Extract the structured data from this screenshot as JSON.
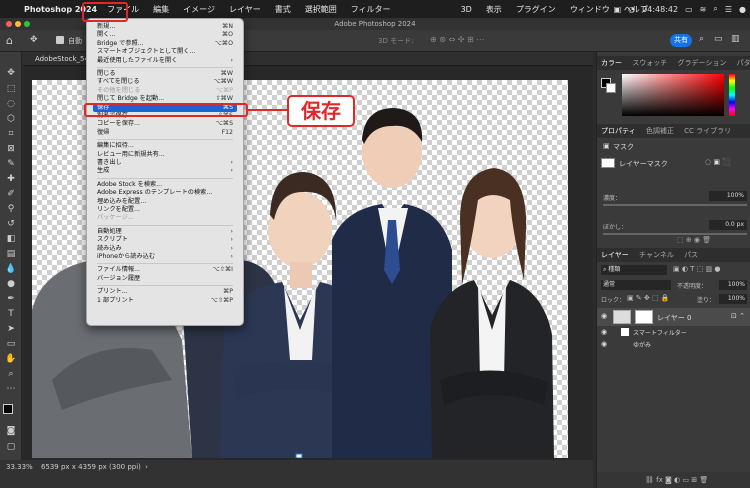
{
  "mac_menu": {
    "app_name": "Photoshop 2024",
    "items": [
      "ファイル",
      "編集",
      "イメージ",
      "レイヤー",
      "書式",
      "選択範囲",
      "フィルター",
      "3D",
      "表示",
      "プラグイン",
      "ウィンドウ",
      "ヘルプ"
    ],
    "clock": "04:48:42"
  },
  "window": {
    "title": "Adobe Photoshop 2024"
  },
  "options_bar": {
    "auto_select_label": "自動",
    "mode_3d": "3D モード:",
    "share_label": "共有"
  },
  "document": {
    "tab_title": "AdobeStock_54"
  },
  "status": {
    "zoom": "33.33%",
    "doc_info": "6539 px x 4359 px (300 ppi)"
  },
  "callout": {
    "text": "保存"
  },
  "file_menu": {
    "items": [
      {
        "label": "新規...",
        "shortcut": "⌘N",
        "disabled": false
      },
      {
        "label": "開く...",
        "shortcut": "⌘O",
        "disabled": false
      },
      {
        "label": "Bridge で参照...",
        "shortcut": "⌥⌘O",
        "disabled": false
      },
      {
        "label": "スマートオブジェクトとして開く...",
        "shortcut": "",
        "disabled": false
      },
      {
        "label": "最近使用したファイルを開く",
        "shortcut": "›",
        "disabled": false
      },
      {
        "sep": true
      },
      {
        "label": "閉じる",
        "shortcut": "⌘W",
        "disabled": false
      },
      {
        "label": "すべてを閉じる",
        "shortcut": "⌥⌘W",
        "disabled": false
      },
      {
        "label": "その他を閉じる",
        "shortcut": "⌥⌘P",
        "disabled": true
      },
      {
        "label": "閉じて Bridge を起動...",
        "shortcut": "⇧⌘W",
        "disabled": false
      },
      {
        "label": "保存",
        "shortcut": "⌘S",
        "disabled": false,
        "highlight": true
      },
      {
        "label": "別名で保存...",
        "shortcut": "⇧⌘S",
        "disabled": false
      },
      {
        "label": "コピーを保存...",
        "shortcut": "⌥⌘S",
        "disabled": false
      },
      {
        "label": "復帰",
        "shortcut": "F12",
        "disabled": false
      },
      {
        "sep": true
      },
      {
        "label": "編集に招待...",
        "shortcut": "",
        "disabled": false
      },
      {
        "label": "レビュー用に新規共有...",
        "shortcut": "",
        "disabled": false
      },
      {
        "label": "書き出し",
        "shortcut": "›",
        "disabled": false
      },
      {
        "label": "生成",
        "shortcut": "›",
        "disabled": false
      },
      {
        "sep": true
      },
      {
        "label": "Adobe Stock を検索...",
        "shortcut": "",
        "disabled": false
      },
      {
        "label": "Adobe Express のテンプレートの検索...",
        "shortcut": "",
        "disabled": false
      },
      {
        "label": "埋め込みを配置...",
        "shortcut": "",
        "disabled": false
      },
      {
        "label": "リンクを配置...",
        "shortcut": "",
        "disabled": false
      },
      {
        "label": "パッケージ...",
        "shortcut": "",
        "disabled": true
      },
      {
        "sep": true
      },
      {
        "label": "自動処理",
        "shortcut": "›",
        "disabled": false
      },
      {
        "label": "スクリプト",
        "shortcut": "›",
        "disabled": false
      },
      {
        "label": "読み込み",
        "shortcut": "›",
        "disabled": false
      },
      {
        "label": "iPhoneから読み込む",
        "shortcut": "›",
        "disabled": false
      },
      {
        "sep": true
      },
      {
        "label": "ファイル情報...",
        "shortcut": "⌥⇧⌘I",
        "disabled": false
      },
      {
        "label": "バージョン履歴",
        "shortcut": "",
        "disabled": false
      },
      {
        "sep": true
      },
      {
        "label": "プリント...",
        "shortcut": "⌘P",
        "disabled": false
      },
      {
        "label": "1 部プリント",
        "shortcut": "⌥⇧⌘P",
        "disabled": false
      }
    ]
  },
  "panels": {
    "color_tabs": [
      "カラー",
      "スウォッチ",
      "グラデーション",
      "パターン"
    ],
    "props_tabs": [
      "プロパティ",
      "色調補正",
      "CC ライブラリ"
    ],
    "mask_label": "マスク",
    "layer_mask_label": "レイヤーマスク",
    "density_label": "濃度：",
    "density_value": "100%",
    "feather_label": "ぼかし：",
    "feather_value": "0.0 px",
    "layers_tabs": [
      "レイヤー",
      "チャンネル",
      "パス"
    ],
    "kind_label": "種類",
    "blend_mode": "通常",
    "opacity_label": "不透明度：",
    "opacity_value": "100%",
    "lock_label": "ロック：",
    "fill_label": "塗り：",
    "fill_value": "100%",
    "layer_name": "レイヤー 0",
    "smart_filter_label": "スマートフィルター",
    "blur_filter_label": "ゆがみ"
  }
}
